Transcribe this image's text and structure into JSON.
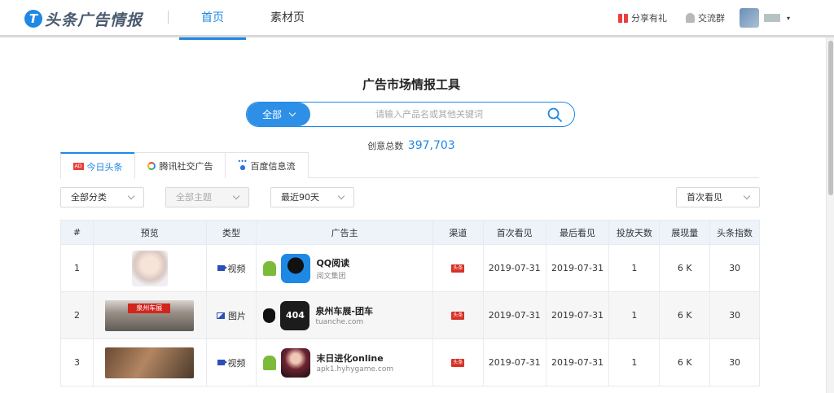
{
  "header": {
    "logo_letter": "T",
    "logo_text": "头条广告情报",
    "nav": [
      {
        "label": "首页",
        "active": true
      },
      {
        "label": "素材页",
        "active": false
      }
    ],
    "share_label": "分享有礼",
    "group_label": "交流群"
  },
  "search": {
    "title": "广告市场情报工具",
    "category": "全部",
    "placeholder": "请输入产品名或其他关键词"
  },
  "total": {
    "label": "创意总数",
    "value": "397,703"
  },
  "platform_tabs": [
    {
      "icon_text": "AD",
      "label": "今日头条",
      "active": true
    },
    {
      "label": "腾讯社交广告",
      "active": false
    },
    {
      "label": "百度信息流",
      "active": false
    }
  ],
  "filters": {
    "category": "全部分类",
    "theme": "全部主题",
    "period": "最近90天",
    "sort": "首次看见"
  },
  "table": {
    "columns": [
      "#",
      "预览",
      "类型",
      "广告主",
      "渠道",
      "首次看见",
      "最后看见",
      "投放天数",
      "展现量",
      "头条指数"
    ],
    "rows": [
      {
        "idx": "1",
        "type": "视频",
        "type_icon": "video-icon",
        "os": "android-icon",
        "name": "QQ阅读",
        "sub": "阅文集团",
        "channel": "头条",
        "first": "2019-07-31",
        "last": "2019-07-31",
        "days": "1",
        "show": "6 K",
        "index": "30"
      },
      {
        "idx": "2",
        "type": "图片",
        "type_icon": "image-icon",
        "os": "apple-icon",
        "banner_text": "泉州车展",
        "logo_text": "404",
        "name": "泉州车展-团车",
        "sub": "tuanche.com",
        "channel": "头条",
        "first": "2019-07-31",
        "last": "2019-07-31",
        "days": "1",
        "show": "6 K",
        "index": "30"
      },
      {
        "idx": "3",
        "type": "视频",
        "type_icon": "video-icon",
        "os": "android-icon",
        "name": "末日进化online",
        "sub": "apk1.hyhygame.com",
        "channel": "头条",
        "first": "2019-07-31",
        "last": "2019-07-31",
        "days": "1",
        "show": "6 K",
        "index": "30"
      }
    ]
  },
  "colors": {
    "accent": "#1e88e5",
    "channel_badge": "#d93025"
  }
}
